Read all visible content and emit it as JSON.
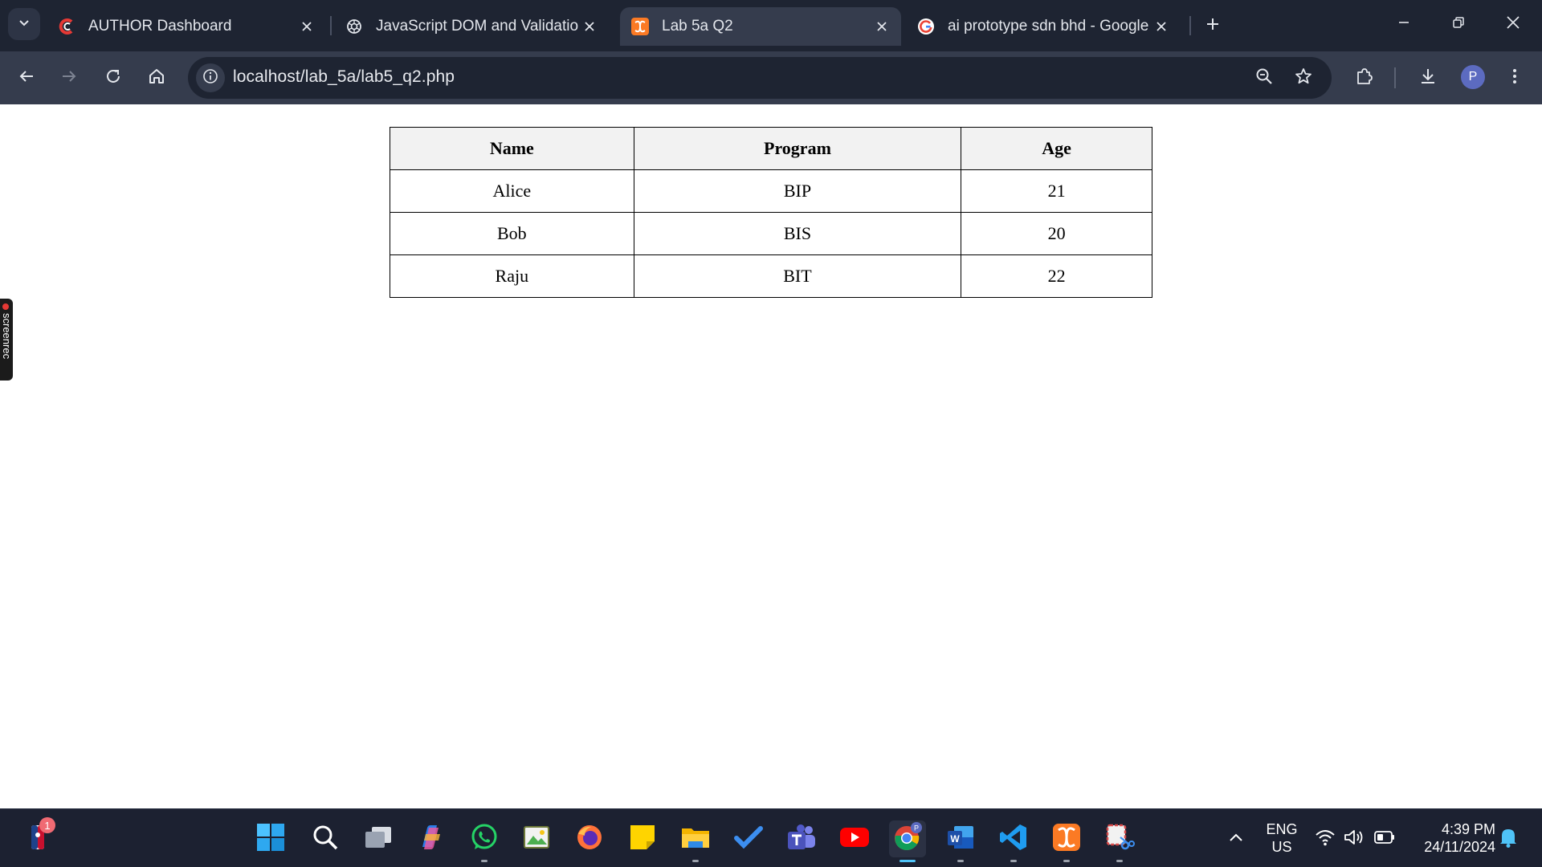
{
  "browser": {
    "tabs": [
      {
        "title": "AUTHOR Dashboard",
        "icon": "author-c-icon"
      },
      {
        "title": "JavaScript DOM and Validation",
        "icon": "chatgpt-icon"
      },
      {
        "title": "Lab 5a Q2",
        "icon": "xampp-icon",
        "active": true
      },
      {
        "title": "ai prototype sdn bhd - Google S",
        "icon": "google-icon"
      }
    ],
    "url": "localhost/lab_5a/lab5_q2.php",
    "profile_initial": "P"
  },
  "page": {
    "table": {
      "headers": [
        "Name",
        "Program",
        "Age"
      ],
      "rows": [
        [
          "Alice",
          "BIP",
          "21"
        ],
        [
          "Bob",
          "BIS",
          "20"
        ],
        [
          "Raju",
          "BIT",
          "22"
        ]
      ]
    }
  },
  "overlay": {
    "screenrec_label": "screenrec"
  },
  "taskbar": {
    "notification_count": "1",
    "language": "ENG",
    "region": "US",
    "time": "4:39 PM",
    "date": "24/11/2024",
    "apps": [
      "start-icon",
      "search-icon",
      "task-view-icon",
      "copilot-icon",
      "whatsapp-icon",
      "photos-icon",
      "firefox-icon",
      "sticky-notes-icon",
      "file-explorer-icon",
      "todo-icon",
      "teams-icon",
      "youtube-icon",
      "chrome-icon",
      "word-icon",
      "vscode-icon",
      "xampp-icon",
      "snipping-tool-icon"
    ]
  },
  "colors": {
    "titlebar": "#1e2432",
    "toolbar": "#353c4d",
    "taskbar": "#1c2131",
    "table_header_bg": "#f2f2f2"
  }
}
